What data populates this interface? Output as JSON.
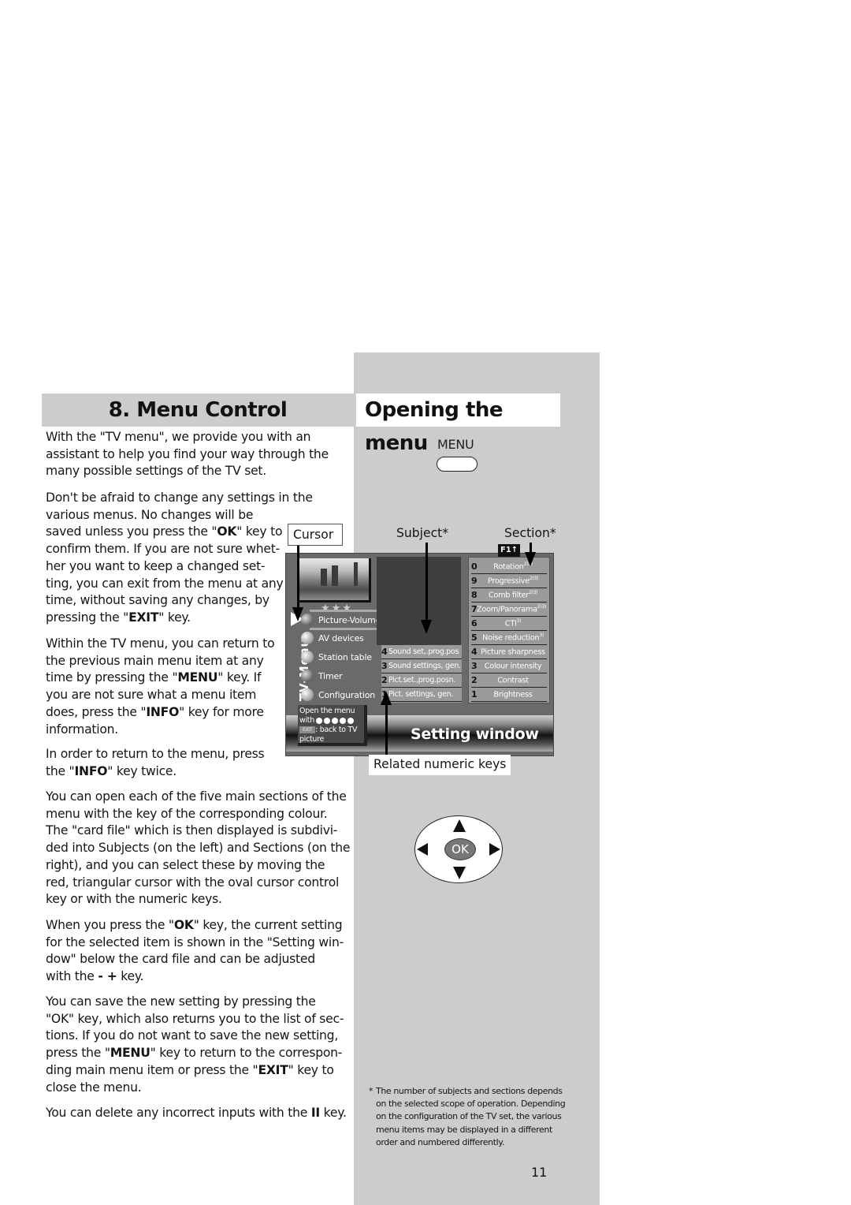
{
  "left_heading": "8. Menu Control",
  "right_heading": "Opening the menu",
  "paragraphs": {
    "p1": [
      "With the \"TV menu\", we provide you with an",
      "assistant to help you find your way through the",
      "many possible settings of the TV set."
    ],
    "p2": [
      "Don't be afraid to change any settings in the",
      "various menus. No changes will be",
      "saved unless you press the \"",
      "OK",
      "\" key to",
      "confirm them. If you are not sure whet-",
      "her you want to keep a changed set-",
      "ting, you can exit from the menu at any",
      "time, without saving any changes, by",
      "pressing the \"",
      "EXIT",
      "\" key."
    ],
    "p3": [
      "Within the TV menu, you can return to",
      "the previous main menu item at any",
      "time by pressing the \"",
      "MENU",
      "\" key. If",
      "you are not sure what a menu item",
      "does, press the \"",
      "INFO",
      "\" key for more",
      "information."
    ],
    "p4": [
      "In order to return to the menu, press",
      "the \"",
      "INFO",
      "\" key twice."
    ],
    "p5": [
      "You can open each of the five main sections of the",
      "menu with the key of the corresponding colour.",
      "The \"card file\" which is then displayed is subdivi-",
      "ded into Subjects (on the left) and Sections (on the",
      "right), and you can select these by moving the",
      "red, triangular cursor with the oval cursor control",
      "key or with the numeric keys."
    ],
    "p6": [
      "When you press the \"",
      "OK",
      "\" key, the current setting",
      "for the selected item is shown in the \"Setting win-",
      "dow\" below the card file and can be adjusted",
      "with the ",
      "- +",
      " key."
    ],
    "p7": [
      "You can save the new setting by pressing the",
      "\"OK\" key, which also returns you to the list of sec-",
      "tions. If you do not want to save the new setting,",
      "press the \"",
      "MENU",
      "\" key to return to the correspon-",
      "ding main menu item or press the \"",
      "EXIT",
      "\" key to",
      "close the menu."
    ],
    "p8": [
      "You can delete any incorrect inputs with the ",
      "II",
      " key."
    ]
  },
  "diagram": {
    "menu_key_label": "MENU",
    "cursor_label": "Cursor",
    "subject_label": "Subject*",
    "section_label": "Section*",
    "related_label": "Related numeric keys",
    "setting_window": "Setting window",
    "tv_vertical_label": "TV-Menu",
    "stars": "★★★",
    "f1_badge": "F1↑",
    "main_items": [
      {
        "label": "Picture-Volume",
        "icon": "ball-icon",
        "active": true
      },
      {
        "label": "AV devices",
        "icon": "ball-icon"
      },
      {
        "label": "Station table",
        "icon": "ball-icon"
      },
      {
        "label": "Timer",
        "icon": "ball-icon"
      },
      {
        "label": "Configuration",
        "icon": "ball-icon"
      }
    ],
    "subjects": [
      {
        "num": "4",
        "label": "Sound set,.prog.pos"
      },
      {
        "num": "3",
        "label": "Sound settings, gen."
      },
      {
        "num": "2",
        "label": "Pict.set.,prog.posn."
      },
      {
        "num": "1",
        "label": "Pict. settings, gen."
      }
    ],
    "sections": [
      {
        "num": "0",
        "label": "Rotation",
        "sup": "2)3)"
      },
      {
        "num": "9",
        "label": "Progressive",
        "sup": "2)3)"
      },
      {
        "num": "8",
        "label": "Comb filter",
        "sup": "2)3)"
      },
      {
        "num": "7",
        "label": "Zoom/Panorama",
        "sup": "2)3)"
      },
      {
        "num": "6",
        "label": "CTI",
        "sup": "3)"
      },
      {
        "num": "5",
        "label": "Noise reduction",
        "sup": "3)"
      },
      {
        "num": "4",
        "label": "Picture sharpness",
        "sup": ""
      },
      {
        "num": "3",
        "label": "Colour intensity",
        "sup": ""
      },
      {
        "num": "2",
        "label": "Contrast",
        "sup": ""
      },
      {
        "num": "1",
        "label": "Brightness",
        "sup": ""
      }
    ],
    "hint": {
      "line1": "Open the menu",
      "line2": "with",
      "exit_chip": "EXIT",
      "line3": ": back to TV",
      "line4": "picture"
    },
    "ok_label": "OK"
  },
  "footnote": {
    "star": "*",
    "text": "The number of subjects and sections depends on the selected scope of operation. Depending on the configuration of the TV set, the various menu items may be displayed in a different order and numbered differently."
  },
  "page_number": "11"
}
